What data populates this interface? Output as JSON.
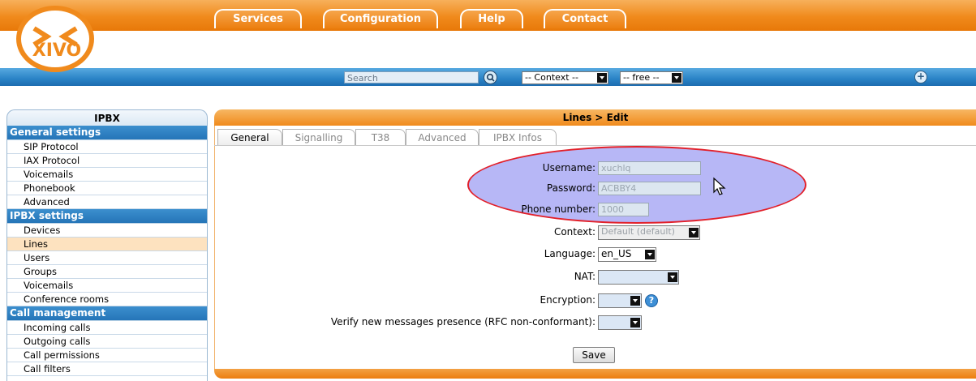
{
  "nav": {
    "tabs": [
      {
        "label": "Services"
      },
      {
        "label": "Configuration"
      },
      {
        "label": "Help"
      },
      {
        "label": "Contact"
      }
    ]
  },
  "logo": {
    "text": "XIVO"
  },
  "toolbar": {
    "search_placeholder": "Search",
    "context_select": "-- Context --",
    "free_select": "-- free --"
  },
  "sidebar": {
    "title": "IPBX",
    "sections": [
      {
        "label": "General settings",
        "items": [
          "SIP Protocol",
          "IAX Protocol",
          "Voicemails",
          "Phonebook",
          "Advanced"
        ]
      },
      {
        "label": "IPBX settings",
        "items": [
          "Devices",
          "Lines",
          "Users",
          "Groups",
          "Voicemails",
          "Conference rooms"
        ]
      },
      {
        "label": "Call management",
        "items": [
          "Incoming calls",
          "Outgoing calls",
          "Call permissions",
          "Call filters"
        ]
      }
    ],
    "active_item": "Lines"
  },
  "main": {
    "title": "Lines > Edit",
    "tabs": [
      "General",
      "Signalling",
      "T38",
      "Advanced",
      "IPBX Infos"
    ],
    "active_tab": "General",
    "form": {
      "username_label": "Username:",
      "username_value": "xuchlq",
      "password_label": "Password:",
      "password_value": "ACBBY4",
      "phone_label": "Phone number:",
      "phone_value": "1000",
      "context_label": "Context:",
      "context_value": "Default (default)",
      "language_label": "Language:",
      "language_value": "en_US",
      "nat_label": "NAT:",
      "nat_value": "",
      "encryption_label": "Encryption:",
      "encryption_value": "",
      "verify_label": "Verify new messages presence (RFC non-conformant):",
      "verify_value": "",
      "save_label": "Save"
    }
  },
  "colors": {
    "orange": "#f08a1c",
    "blue": "#2a83c6",
    "highlight": "#8787f0",
    "highlight_border": "#e2202a"
  }
}
